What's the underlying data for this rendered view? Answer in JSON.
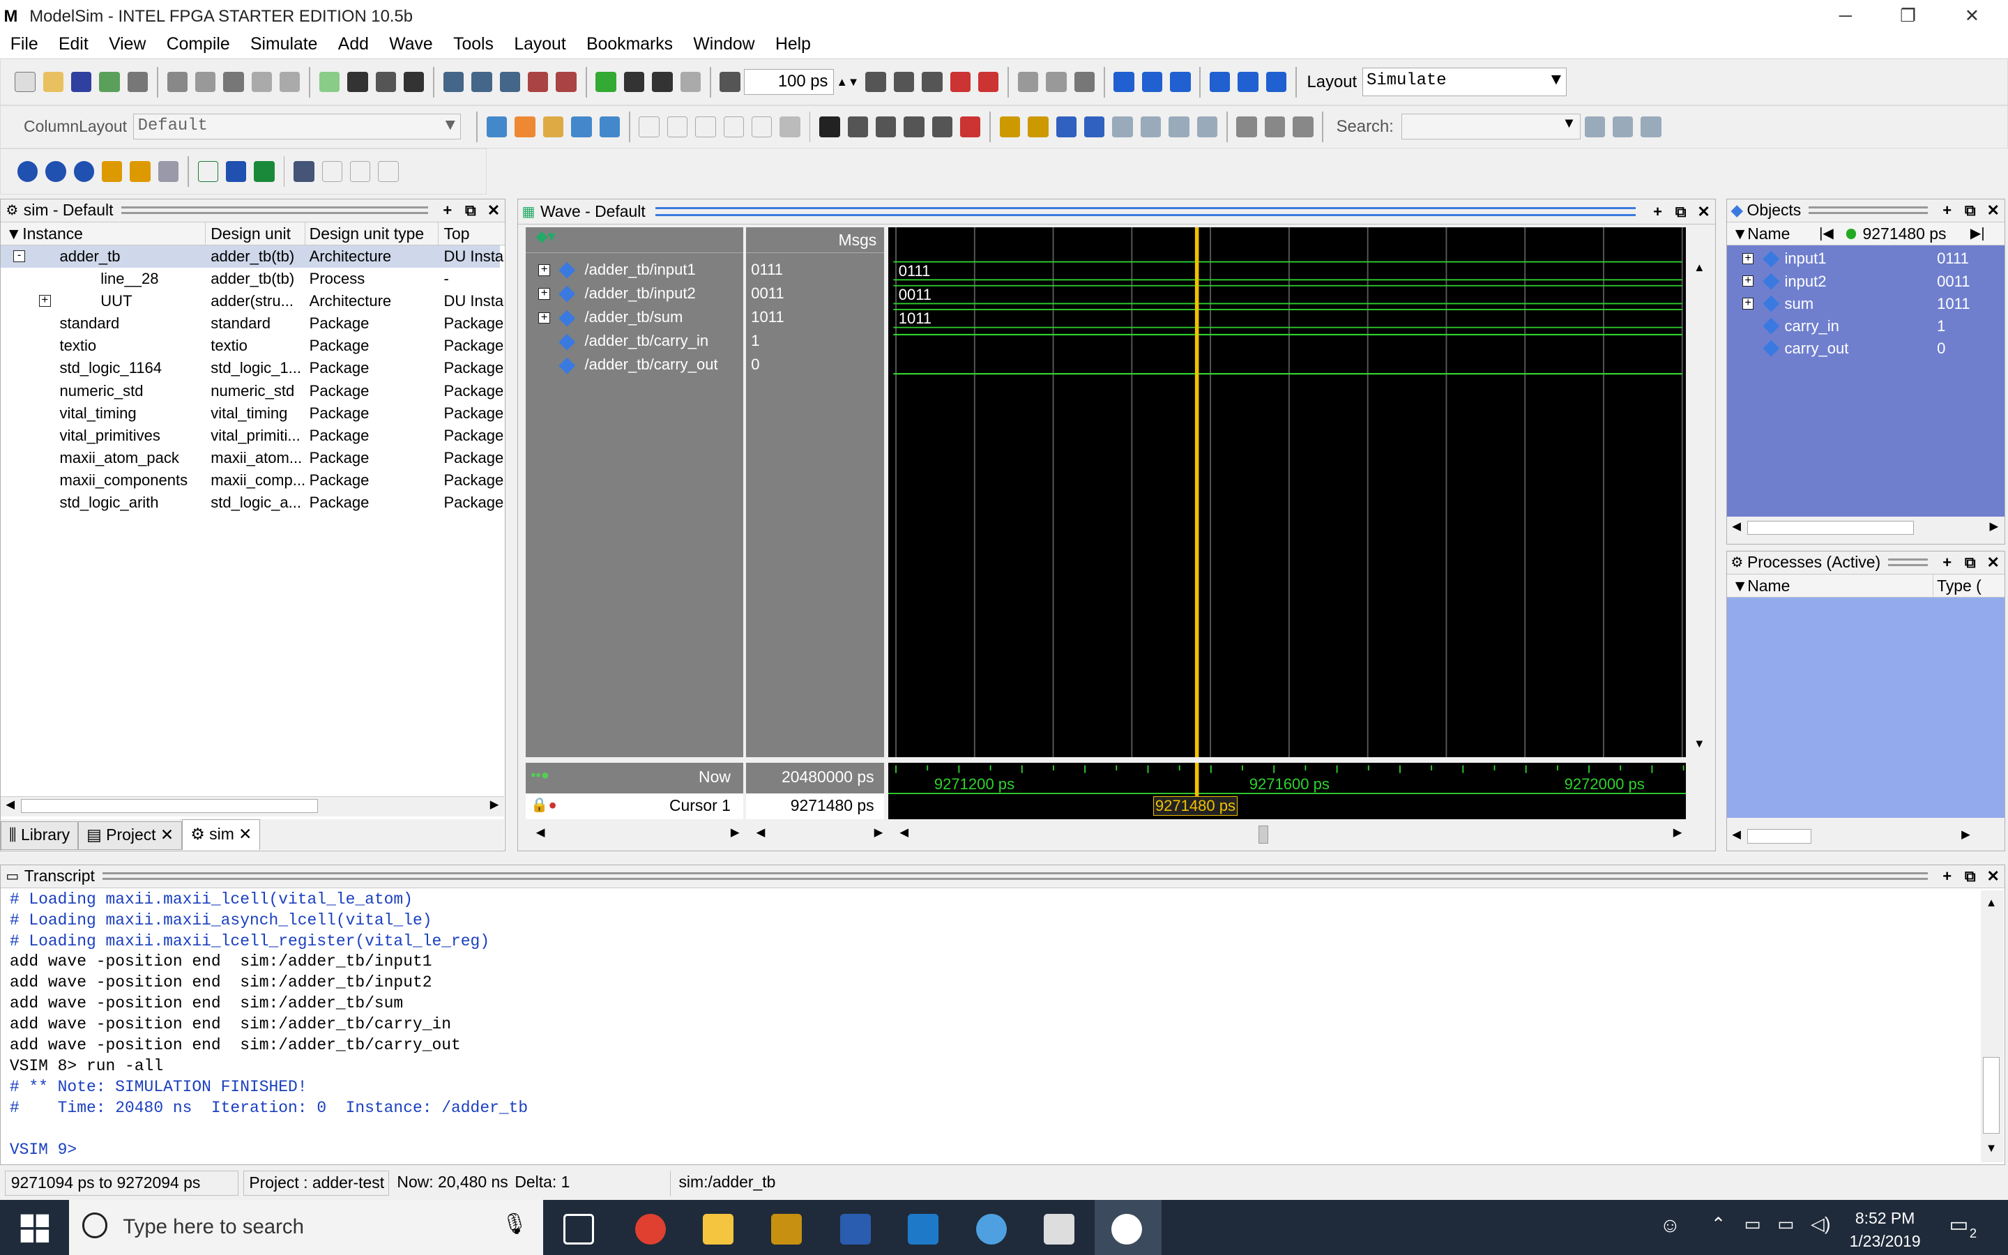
{
  "window": {
    "title": "ModelSim - INTEL FPGA STARTER EDITION 10.5b",
    "app_letter": "M",
    "minimize": "─",
    "restore": "❐",
    "close": "✕"
  },
  "menu": [
    "File",
    "Edit",
    "View",
    "Compile",
    "Simulate",
    "Add",
    "Wave",
    "Tools",
    "Layout",
    "Bookmarks",
    "Window",
    "Help"
  ],
  "toolbar": {
    "time_step": "100 ps",
    "layout_label": "Layout",
    "layout_value": "Simulate",
    "column_layout_label": "ColumnLayout",
    "column_layout_value": "Default",
    "search_label": "Search:"
  },
  "sim_pane": {
    "title": "sim - Default",
    "columns": [
      "Instance",
      "Design unit",
      "Design unit type",
      "Top Cate"
    ],
    "rows": [
      {
        "instance": "adder_tb",
        "unit": "adder_tb(tb)",
        "type": "Architecture",
        "cat": "DU Insta"
      },
      {
        "instance": "line__28",
        "unit": "adder_tb(tb)",
        "type": "Process",
        "cat": "-"
      },
      {
        "instance": "UUT",
        "unit": "adder(stru...",
        "type": "Architecture",
        "cat": "DU Insta"
      },
      {
        "instance": "standard",
        "unit": "standard",
        "type": "Package",
        "cat": "Package"
      },
      {
        "instance": "textio",
        "unit": "textio",
        "type": "Package",
        "cat": "Package"
      },
      {
        "instance": "std_logic_1164",
        "unit": "std_logic_1...",
        "type": "Package",
        "cat": "Package"
      },
      {
        "instance": "numeric_std",
        "unit": "numeric_std",
        "type": "Package",
        "cat": "Package"
      },
      {
        "instance": "vital_timing",
        "unit": "vital_timing",
        "type": "Package",
        "cat": "Package"
      },
      {
        "instance": "vital_primitives",
        "unit": "vital_primiti...",
        "type": "Package",
        "cat": "Package"
      },
      {
        "instance": "maxii_atom_pack",
        "unit": "maxii_atom...",
        "type": "Package",
        "cat": "Package"
      },
      {
        "instance": "maxii_components",
        "unit": "maxii_comp...",
        "type": "Package",
        "cat": "Package"
      },
      {
        "instance": "std_logic_arith",
        "unit": "std_logic_a...",
        "type": "Package",
        "cat": "Package"
      }
    ],
    "tabs": [
      "Library",
      "Project",
      "sim"
    ]
  },
  "wave_pane": {
    "title": "Wave - Default",
    "msgs_header": "Msgs",
    "signals": [
      {
        "name": "/adder_tb/input1",
        "value": "0111",
        "wave": "0111"
      },
      {
        "name": "/adder_tb/input2",
        "value": "0011",
        "wave": "0011"
      },
      {
        "name": "/adder_tb/sum",
        "value": "1011",
        "wave": "1011"
      },
      {
        "name": "/adder_tb/carry_in",
        "value": "1",
        "wave": ""
      },
      {
        "name": "/adder_tb/carry_out",
        "value": "0",
        "wave": ""
      }
    ],
    "now_label": "Now",
    "now_value": "20480000 ps",
    "cursor_label": "Cursor 1",
    "cursor_value": "9271480 ps",
    "time_ticks": [
      "9271200 ps",
      "9271600 ps",
      "9272000 ps"
    ],
    "cursor_marker": "9271480 ps"
  },
  "objects_pane": {
    "title": "Objects",
    "col_name": "Name",
    "time": "9271480 ps",
    "rows": [
      {
        "name": "input1",
        "value": "0111"
      },
      {
        "name": "input2",
        "value": "0011"
      },
      {
        "name": "sum",
        "value": "1011"
      },
      {
        "name": "carry_in",
        "value": "1"
      },
      {
        "name": "carry_out",
        "value": "0"
      }
    ]
  },
  "processes_pane": {
    "title": "Processes (Active)",
    "col_name": "Name",
    "col_type": "Type ("
  },
  "transcript": {
    "title": "Transcript",
    "lines": [
      {
        "text": "# Loading maxii.maxii_lcell(vital_le_atom)",
        "color": "#1a3fbf"
      },
      {
        "text": "# Loading maxii.maxii_asynch_lcell(vital_le)",
        "color": "#1a3fbf"
      },
      {
        "text": "# Loading maxii.maxii_lcell_register(vital_le_reg)",
        "color": "#1a3fbf"
      },
      {
        "text": "add wave -position end  sim:/adder_tb/input1",
        "color": "#000000"
      },
      {
        "text": "add wave -position end  sim:/adder_tb/input2",
        "color": "#000000"
      },
      {
        "text": "add wave -position end  sim:/adder_tb/sum",
        "color": "#000000"
      },
      {
        "text": "add wave -position end  sim:/adder_tb/carry_in",
        "color": "#000000"
      },
      {
        "text": "add wave -position end  sim:/adder_tb/carry_out",
        "color": "#000000"
      },
      {
        "text": "VSIM 8> run -all",
        "color": "#000000"
      },
      {
        "text": "# ** Note: SIMULATION FINISHED!",
        "color": "#1a3fbf"
      },
      {
        "text": "#    Time: 20480 ns  Iteration: 0  Instance: /adder_tb",
        "color": "#1a3fbf"
      },
      {
        "text": "",
        "color": "#000000"
      },
      {
        "text": "VSIM 9>",
        "color": "#1a3fbf"
      }
    ]
  },
  "statusbar": {
    "range": "9271094 ps to 9272094 ps",
    "project": "Project : adder-test",
    "now": "Now: 20,480 ns",
    "delta": "Delta: 1",
    "context": "sim:/adder_tb"
  },
  "taskbar": {
    "search_placeholder": "Type here to search",
    "time": "8:52 PM",
    "date": "1/23/2019",
    "notif_count": "2"
  },
  "colors": {
    "wave_green": "#2fd12f",
    "cursor_yellow": "#f0c000",
    "objects_bg": "#6f7fce"
  }
}
